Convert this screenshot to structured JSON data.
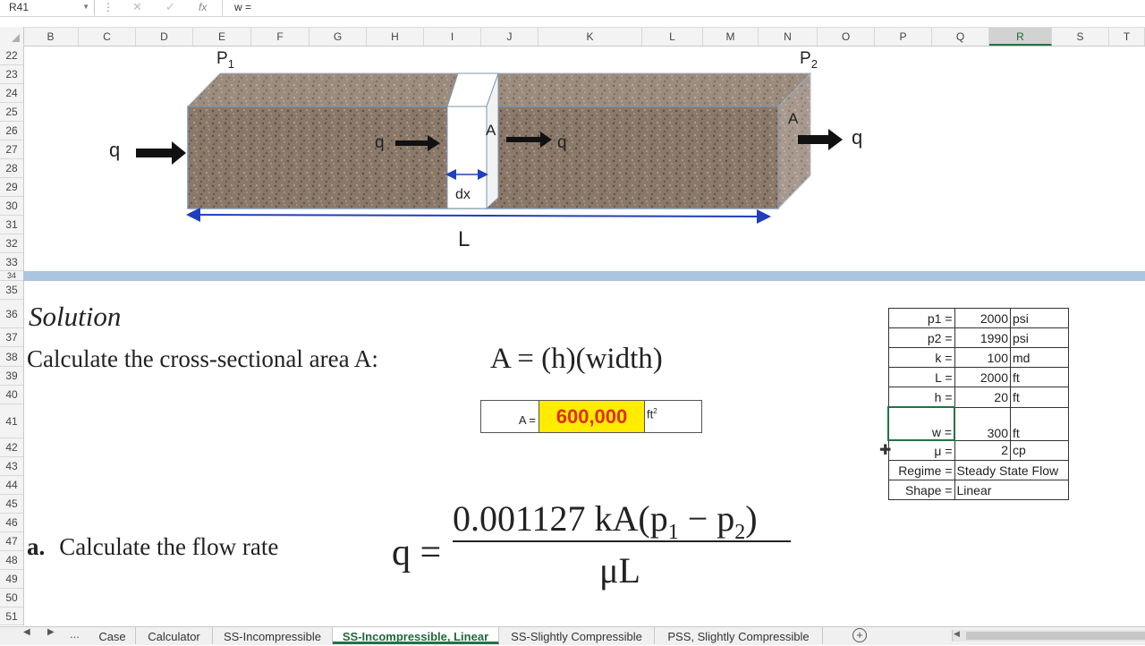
{
  "formula_bar": {
    "cell_ref": "R41",
    "formula": "w =",
    "fx": "fx",
    "cancel": "✕",
    "enter": "✓",
    "dots": "⋮"
  },
  "columns": [
    "B",
    "C",
    "D",
    "E",
    "F",
    "G",
    "H",
    "I",
    "J",
    "K",
    "L",
    "M",
    "N",
    "O",
    "P",
    "Q",
    "R",
    "S",
    "T"
  ],
  "selected_column": "R",
  "rows": [
    "22",
    "23",
    "24",
    "25",
    "26",
    "27",
    "28",
    "29",
    "30",
    "31",
    "32",
    "33",
    "34",
    "35",
    "36",
    "37",
    "38",
    "39",
    "40",
    "41",
    "42",
    "43",
    "44",
    "45",
    "46",
    "47",
    "48",
    "49",
    "50",
    "51"
  ],
  "diagram": {
    "p1": "P",
    "p1_sub": "1",
    "p2": "P",
    "p2_sub": "2",
    "q_in": "q",
    "q_mid_in": "q",
    "q_mid_out": "q",
    "q_out": "q",
    "area_mid": "A",
    "area_end": "A",
    "dx": "dx",
    "length": "L"
  },
  "solution": {
    "heading": "Solution",
    "calc_area": "Calculate the cross-sectional area A:",
    "area_formula": "A = (h)(width)",
    "a_label": "A =",
    "a_value": "600,000",
    "a_unit": "ft",
    "a_unit_exp": "2",
    "step_a_letter": "a.",
    "step_a_text": "Calculate the flow rate",
    "q_lhs": "q =",
    "q_num_main": "0.001127 kA(p",
    "q_num_sub1": "1",
    "q_num_mid": " − p",
    "q_num_sub2": "2",
    "q_num_end": ")",
    "q_den": "μL"
  },
  "params": [
    {
      "label": "p1 =",
      "value": "2000",
      "unit": "psi"
    },
    {
      "label": "p2 =",
      "value": "1990",
      "unit": "psi"
    },
    {
      "label": "k =",
      "value": "100",
      "unit": "md"
    },
    {
      "label": "L =",
      "value": "2000",
      "unit": "ft"
    },
    {
      "label": "h =",
      "value": "20",
      "unit": "ft"
    },
    {
      "label": "w =",
      "value": "300",
      "unit": "ft"
    },
    {
      "label": "μ =",
      "value": "2",
      "unit": "cp"
    },
    {
      "label": "Regime =",
      "value": "Steady State Flow",
      "unit": ""
    },
    {
      "label": "Shape =",
      "value": "Linear",
      "unit": ""
    }
  ],
  "tabs": [
    "Case",
    "Calculator",
    "SS-Incompressible",
    "SS-Incompressible, Linear",
    "SS-Slightly Compressible",
    "PSS, Slightly Compressible"
  ],
  "active_tab": "SS-Incompressible, Linear",
  "tab_nav": {
    "prev": "◀",
    "next": "▶",
    "more": "...",
    "add": "+"
  },
  "colors": {
    "highlight": "#ffec00",
    "value_red": "#e32c1b",
    "excel_green": "#217346",
    "divider_blue": "#a9c5e0"
  }
}
